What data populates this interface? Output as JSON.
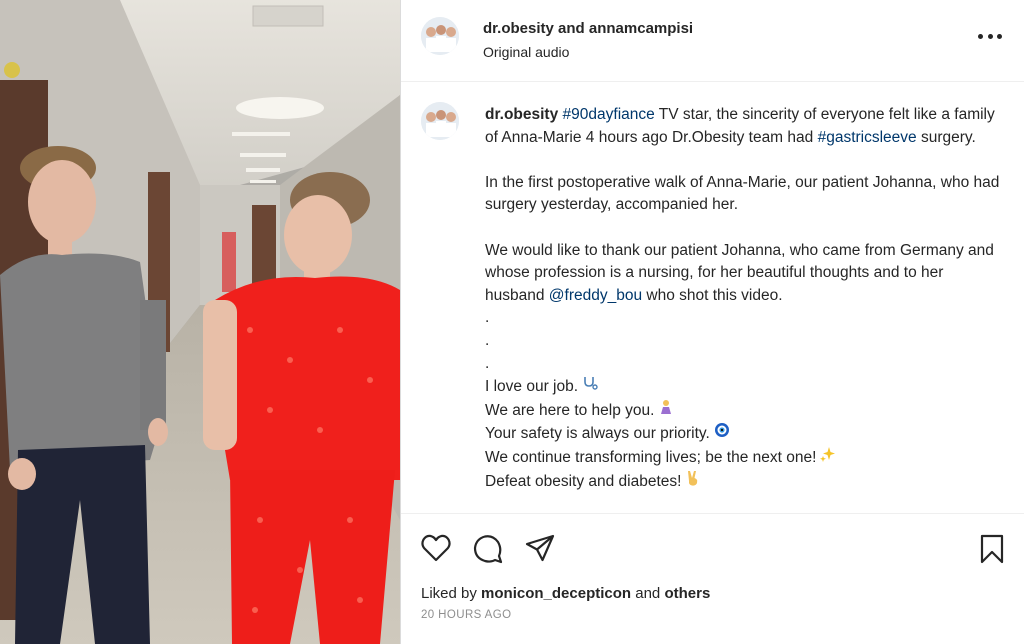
{
  "header": {
    "user1": "dr.obesity",
    "connector": "and",
    "user2": "annamcampisi",
    "audio": "Original audio"
  },
  "caption": {
    "username": "dr.obesity",
    "line1_tag": "#90dayfiance",
    "line1_text": " TV star, the sincerity of everyone felt like a family of Anna-Marie 4 hours ago Dr.Obesity team had ",
    "line1_tag2": "#gastricsleeve",
    "line1_end": " surgery.",
    "para2": "In the first postoperative walk of Anna-Marie, our patient Johanna, who had surgery yesterday, accompanied her.",
    "para3_start": "We would like to thank our patient Johanna, who came from Germany and whose profession is a nursing, for her beautiful thoughts and to her husband ",
    "para3_mention": "@freddy_bou",
    "para3_end": " who shot this video.",
    "dot": ".",
    "line_love": "I love our job.",
    "line_help": "We are here to help you.",
    "line_safety": "Your safety is always our priority.",
    "line_transform": "We continue transforming lives; be the next one!",
    "line_defeat": "Defeat obesity and diabetes!",
    "emojis": {
      "love": "stethoscope-emoji",
      "help": "praying-emoji",
      "safety": "nazar-emoji",
      "transform": "sparkles-emoji",
      "defeat": "victory-hand-emoji"
    }
  },
  "actions": {
    "icons": [
      "heart-icon",
      "comment-icon",
      "share-icon",
      "bookmark-icon"
    ]
  },
  "likes": {
    "prefix": "Liked by",
    "user": "monicon_decepticon",
    "connector": "and",
    "others": "others"
  },
  "timestamp": "20 HOURS AGO",
  "colors": {
    "text": "#262626",
    "link": "#00376b",
    "muted": "#8e8e8e",
    "pajama": "#f0201c"
  }
}
